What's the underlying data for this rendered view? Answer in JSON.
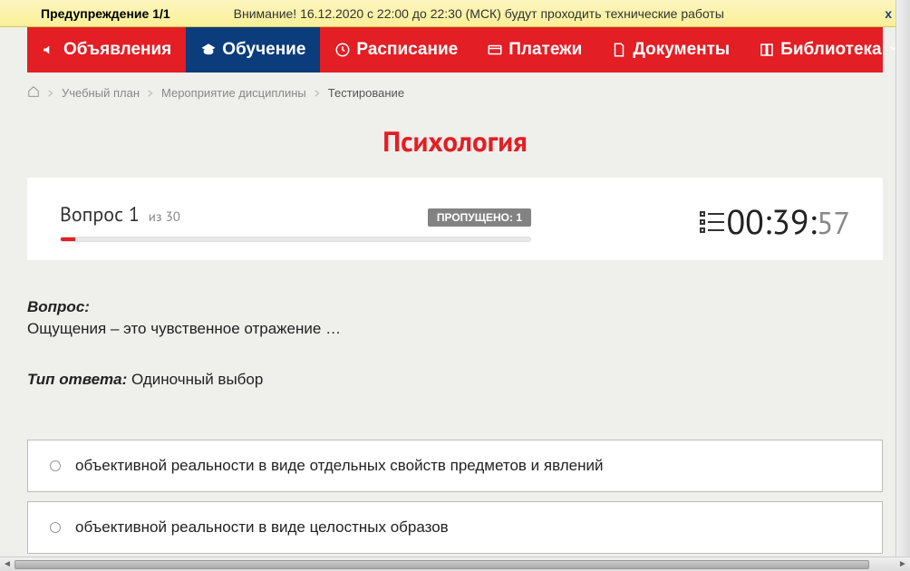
{
  "alert": {
    "title": "Предупреждение 1/1",
    "message": "Внимание! 16.12.2020 с 22:00 до 22:30 (МСК) будут проходить технические работы",
    "close": "x"
  },
  "nav": {
    "items": [
      {
        "label": "Объявления",
        "icon": "megaphone",
        "active": false
      },
      {
        "label": "Обучение",
        "icon": "graduation",
        "active": true
      },
      {
        "label": "Расписание",
        "icon": "clock",
        "active": false
      },
      {
        "label": "Платежи",
        "icon": "card",
        "active": false
      },
      {
        "label": "Документы",
        "icon": "document",
        "active": false
      },
      {
        "label": "Библиотека",
        "icon": "book",
        "active": false,
        "dropdown": true
      }
    ]
  },
  "breadcrumbs": {
    "items": [
      "Учебный план",
      "Мероприятие дисциплины"
    ],
    "current": "Тестирование"
  },
  "page_title": "Психология",
  "status": {
    "question_prefix": "Вопрос",
    "question_num": "1",
    "question_of": "из",
    "question_total": "30",
    "skipped_label": "ПРОПУЩЕНО: 1",
    "timer_mm": "00:39:",
    "timer_ss": "57"
  },
  "question": {
    "label": "Вопрос:",
    "text": "Ощущения – это чувственное отражение …",
    "answer_type_label": "Тип ответа:",
    "answer_type_value": "Одиночный выбор"
  },
  "answers": [
    {
      "text": "объективной реальности в виде отдельных свойств предметов и явлений"
    },
    {
      "text": "объективной реальности в виде целостных образов"
    }
  ]
}
